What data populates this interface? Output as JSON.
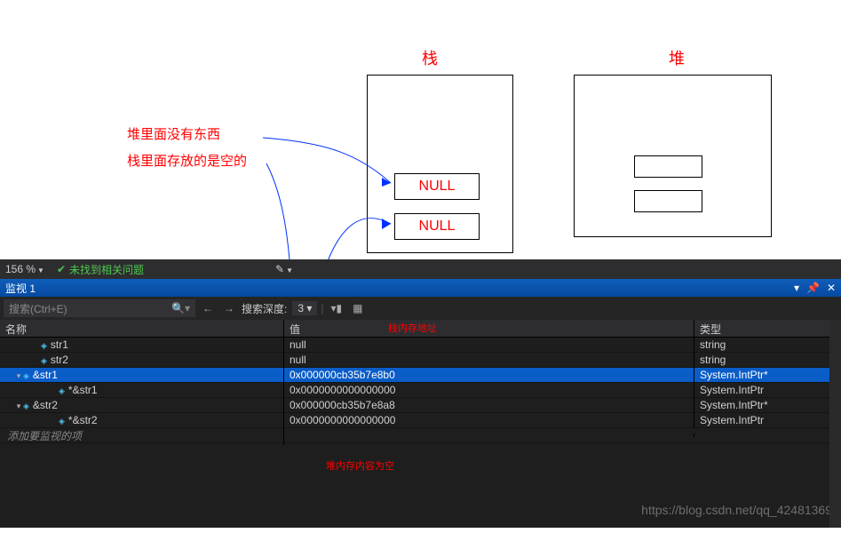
{
  "top": {
    "stack_title": "栈",
    "heap_title": "堆",
    "note1": "堆里面没有东西",
    "note2": "栈里面存放的是空的",
    "null_label": "NULL"
  },
  "ide": {
    "zoom": "156 %",
    "status_ok": "未找到相关问题",
    "panel_title": "监视 1",
    "search_placeholder": "搜索(Ctrl+E)",
    "depth_label": "搜索深度:",
    "depth_value": "3",
    "columns": {
      "name": "名称",
      "value": "值",
      "type": "类型"
    },
    "rows": [
      {
        "depth": 1,
        "exp": "",
        "name": "str1",
        "value": "null",
        "type": "string",
        "sel": false
      },
      {
        "depth": 1,
        "exp": "",
        "name": "str2",
        "value": "null",
        "type": "string",
        "sel": false
      },
      {
        "depth": 0,
        "exp": "▾",
        "name": "&str1",
        "value": "0x000000cb35b7e8b0",
        "type": "System.IntPtr*",
        "sel": true
      },
      {
        "depth": 2,
        "exp": "",
        "name": "*&str1",
        "value": "0x0000000000000000",
        "type": "System.IntPtr",
        "sel": false
      },
      {
        "depth": 0,
        "exp": "▾",
        "name": "&str2",
        "value": "0x000000cb35b7e8a8",
        "type": "System.IntPtr*",
        "sel": false
      },
      {
        "depth": 2,
        "exp": "",
        "name": "*&str2",
        "value": "0x0000000000000000",
        "type": "System.IntPtr",
        "sel": false
      }
    ],
    "add_hint": "添加要监视的项",
    "anno_stack_addr": "栈内存地址",
    "anno_heap_empty": "堆内存内容为空",
    "footer": "https://blog.csdn.net/qq_42481369"
  }
}
